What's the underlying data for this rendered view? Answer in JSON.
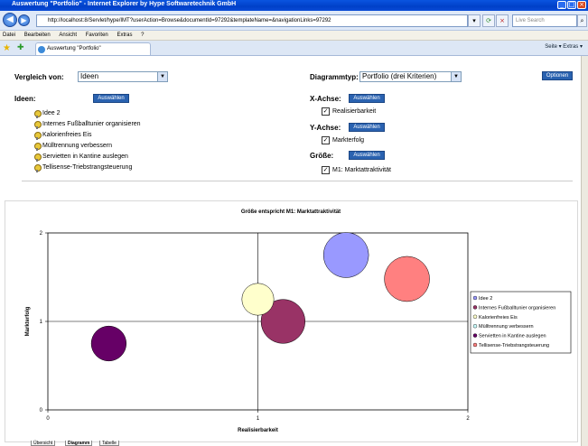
{
  "window": {
    "title": "Auswertung \"Portfolio\" - Internet Explorer by Hype Softwaretechnik GmbH",
    "url": "http://localhost:8/Servlet/hype/IMT?userAction=Browse&documentId=97292&templateName=&navigationLinks=97292",
    "search_placeholder": "Live Search",
    "menu": [
      "Datei",
      "Bearbeiten",
      "Ansicht",
      "Favoriten",
      "Extras",
      "?"
    ],
    "tab_label": "Auswertung \"Portfolio\"",
    "toolbar_right": "Seite ▾  Extras ▾"
  },
  "form": {
    "vergleich_label": "Vergleich von:",
    "vergleich_value": "Ideen",
    "diagrammtyp_label": "Diagrammtyp:",
    "diagrammtyp_value": "Portfolio (drei Kriterien)",
    "optionen_label": "Optionen",
    "ideen_label": "Ideen:",
    "auswaehlen_label": "Auswählen",
    "ideas": [
      "Idee 2",
      "Internes Fußballtunier organisieren",
      "Kalorienfreies Eis",
      "Mülltrennung verbessern",
      "Servietten in Kantine auslegen",
      "Tellisense-Triebstrangsteuerung"
    ],
    "x_axis_label": "X-Achse:",
    "x_axis_value": "Realisierbarkeit",
    "y_axis_label": "Y-Achse:",
    "y_axis_value": "Markterfolg",
    "size_label": "Größe:",
    "size_value": "M1: Marktattraktivität"
  },
  "bottom_tabs": [
    "Übersicht",
    "Diagramm",
    "Tabelle"
  ],
  "colors": {
    "title_bar": "#0a54e0",
    "button_blue": "#2a62b0"
  },
  "chart_data": {
    "type": "bubble",
    "title": "Größe entspricht M1: Marktattraktivität",
    "xlabel": "Realisierbarkeit",
    "ylabel": "Markterfolg",
    "xlim": [
      0,
      2
    ],
    "ylim": [
      0,
      2
    ],
    "xticks": [
      "0",
      "1",
      "2"
    ],
    "yticks": [
      "0",
      "1",
      "2"
    ],
    "legend_position": "right",
    "series": [
      {
        "name": "Idee 2",
        "x": 1.42,
        "y": 1.75,
        "size": 1.0,
        "color": "#9999ff"
      },
      {
        "name": "Internes Fußballtunier organisieren",
        "x": 1.12,
        "y": 1.0,
        "size": 0.95,
        "color": "#993366"
      },
      {
        "name": "Kalorienfreies Eis",
        "x": 1.0,
        "y": 1.25,
        "size": 0.5,
        "color": "#ffffcc"
      },
      {
        "name": "Mülltrennung verbessern",
        "x": 0.0,
        "y": 0.0,
        "size": 0.0,
        "color": "#ccffff"
      },
      {
        "name": "Servietten in Kantine auslegen",
        "x": 0.29,
        "y": 0.75,
        "size": 0.6,
        "color": "#660066"
      },
      {
        "name": "Tellisense-Triebstrangsteuerung",
        "x": 1.71,
        "y": 1.48,
        "size": 1.0,
        "color": "#ff8080"
      }
    ]
  }
}
